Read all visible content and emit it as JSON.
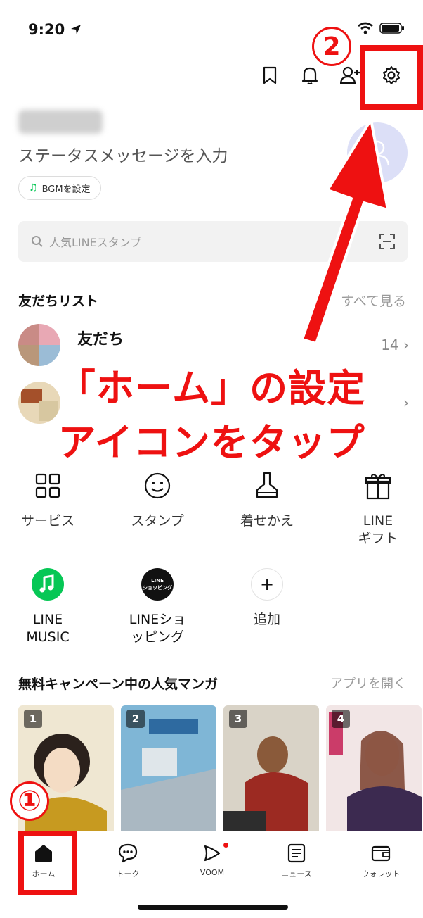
{
  "status": {
    "time": "9:20"
  },
  "profile": {
    "status_message": "ステータスメッセージを入力",
    "bgm_label": "BGMを設定"
  },
  "search": {
    "placeholder": "人気LINEスタンプ"
  },
  "friends": {
    "title": "友だちリスト",
    "see_all": "すべて見る",
    "rows": [
      {
        "label": "友だち",
        "count": "14"
      }
    ]
  },
  "annotation": {
    "line1": "「ホーム」の設定",
    "line2": "アイコンをタップ",
    "marker1": "①",
    "marker2": "2",
    "color": "#ee1111"
  },
  "services": [
    {
      "icon": "grid-icon",
      "label": "サービス"
    },
    {
      "icon": "smiley-icon",
      "label": "スタンプ"
    },
    {
      "icon": "brush-icon",
      "label": "着せかえ"
    },
    {
      "icon": "gift-icon",
      "label": "LINE\nギフト"
    },
    {
      "icon": "music-app-icon",
      "label": "LINE\nMUSIC"
    },
    {
      "icon": "shopping-app-icon",
      "label": "LINEショ\nッピング",
      "badge": "LINE\nショッピング"
    },
    {
      "icon": "plus-icon",
      "label": "追加"
    }
  ],
  "manga": {
    "title": "無料キャンペーン中の人気マンガ",
    "open_app": "アプリを開く",
    "items": [
      {
        "rank": "1"
      },
      {
        "rank": "2"
      },
      {
        "rank": "3"
      },
      {
        "rank": "4"
      }
    ]
  },
  "tabs": [
    {
      "label": "ホーム",
      "icon": "home-icon",
      "active": true
    },
    {
      "label": "トーク",
      "icon": "chat-icon"
    },
    {
      "label": "VOOM",
      "icon": "voom-icon"
    },
    {
      "label": "ニュース",
      "icon": "news-icon"
    },
    {
      "label": "ウォレット",
      "icon": "wallet-icon"
    }
  ],
  "colors": {
    "line_green": "#06c755",
    "accent_red": "#ee1111"
  }
}
